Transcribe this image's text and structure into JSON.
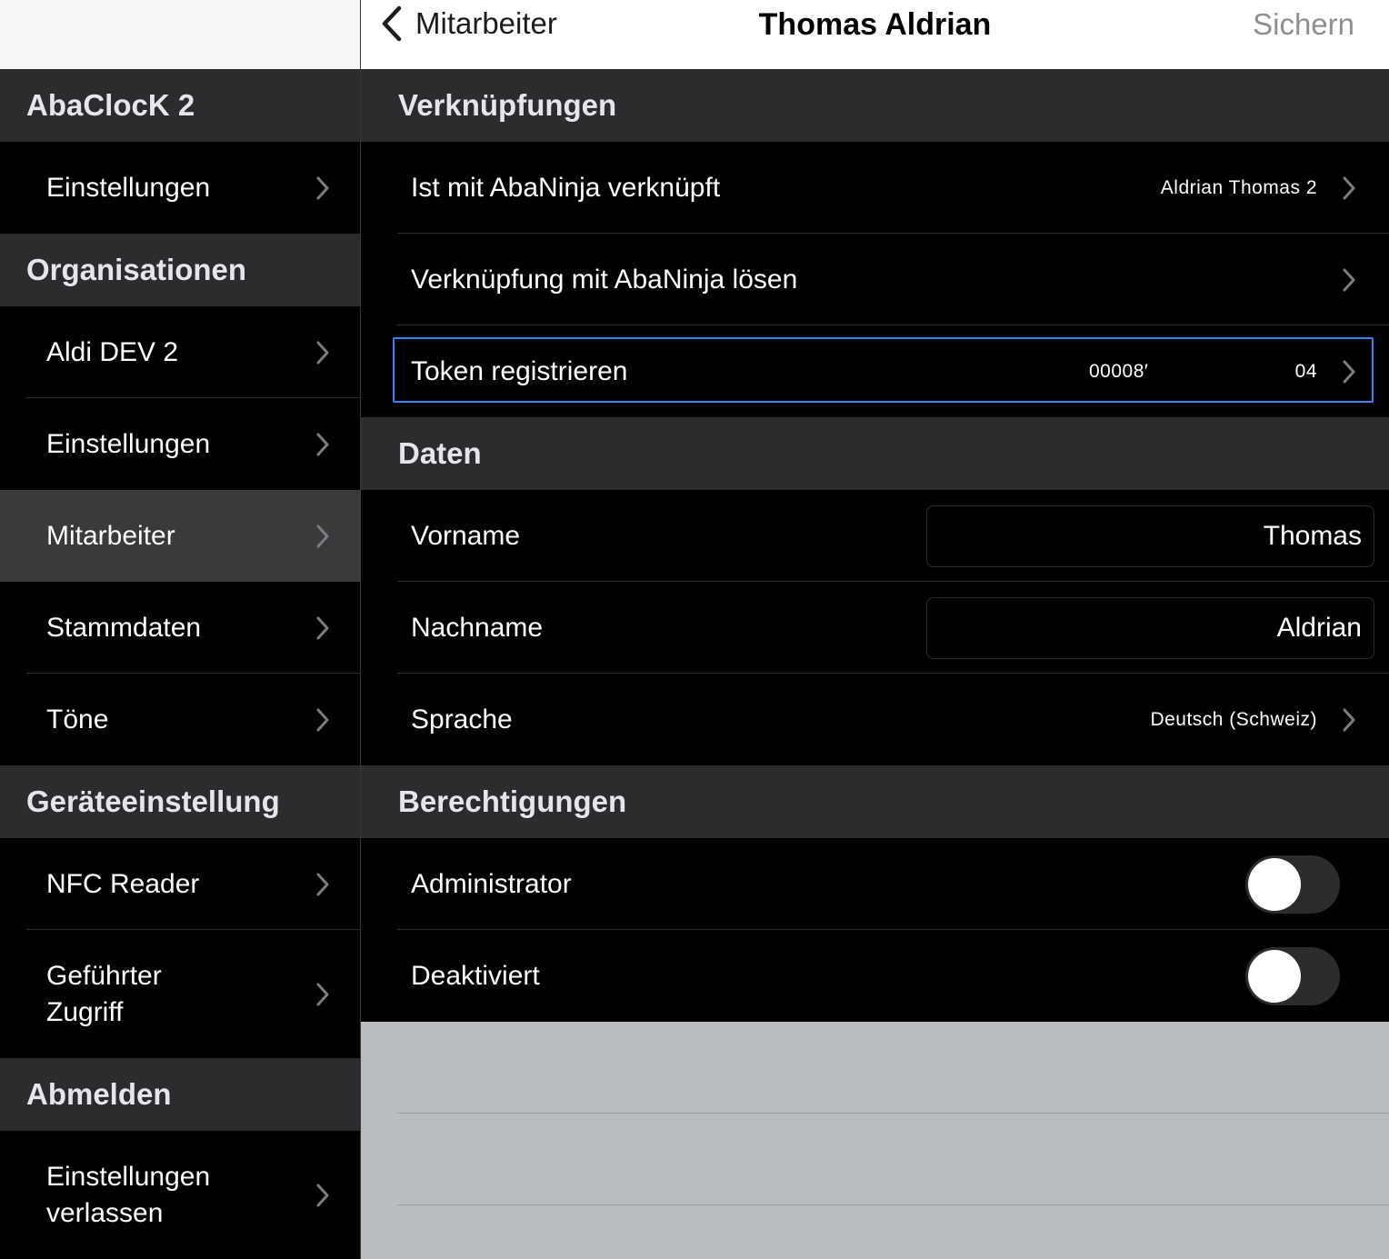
{
  "sidebar": {
    "sections": [
      {
        "title": "AbaClocK 2",
        "items": [
          {
            "label": "Einstellungen"
          }
        ]
      },
      {
        "title": "Organisationen",
        "items": [
          {
            "label": "Aldi DEV 2"
          },
          {
            "label": "Einstellungen"
          },
          {
            "label": "Mitarbeiter",
            "selected": true
          },
          {
            "label": "Stammdaten"
          },
          {
            "label": "Töne"
          }
        ]
      },
      {
        "title": "Geräteeinstellung",
        "items": [
          {
            "label": "NFC Reader"
          },
          {
            "label": "Geführter Zugriff"
          }
        ]
      },
      {
        "title": "Abmelden",
        "items": [
          {
            "label": "Einstellungen verlassen"
          }
        ]
      }
    ]
  },
  "navbar": {
    "back_label": "Mitarbeiter",
    "title": "Thomas Aldrian",
    "save_label": "Sichern"
  },
  "links_section": {
    "title": "Verknüpfungen",
    "linked": {
      "label": "Ist mit AbaNinja verknüpft",
      "value": "Aldrian Thomas 2"
    },
    "unlink": {
      "label": "Verknüpfung mit AbaNinja lösen"
    },
    "token": {
      "label": "Token registrieren",
      "value_start": "00008′",
      "value_end": "04"
    }
  },
  "data_section": {
    "title": "Daten",
    "first_name": {
      "label": "Vorname",
      "value": "Thomas"
    },
    "last_name": {
      "label": "Nachname",
      "value": "Aldrian"
    },
    "language": {
      "label": "Sprache",
      "value": "Deutsch (Schweiz)"
    }
  },
  "permissions_section": {
    "title": "Berechtigungen",
    "admin": {
      "label": "Administrator",
      "on": false
    },
    "deactivated": {
      "label": "Deaktiviert",
      "on": false
    }
  },
  "colors": {
    "background": "#000000",
    "section_header": "#2c2c2e",
    "selected_row": "#3a3a3c",
    "focus_ring": "#3a82f7",
    "empty_area": "#babdc0"
  }
}
